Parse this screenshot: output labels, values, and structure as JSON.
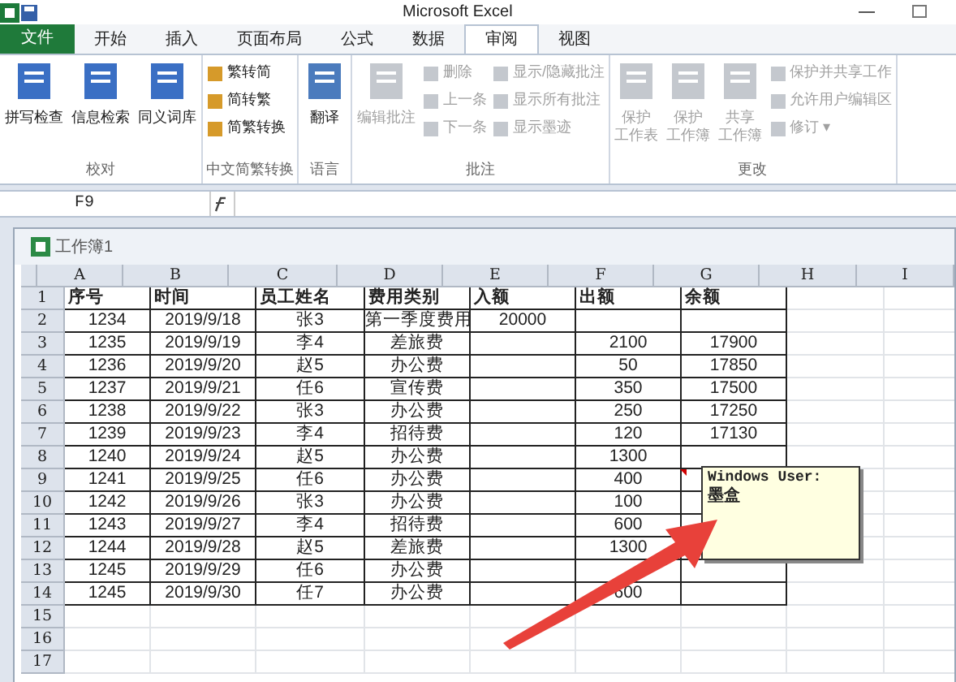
{
  "window": {
    "title": "Microsoft Excel"
  },
  "tabs": [
    {
      "label": "文件",
      "kind": "file",
      "selected": false
    },
    {
      "label": "开始",
      "kind": "tab",
      "selected": false
    },
    {
      "label": "插入",
      "kind": "tab",
      "selected": false
    },
    {
      "label": "页面布局",
      "kind": "tab",
      "selected": false
    },
    {
      "label": "公式",
      "kind": "tab",
      "selected": false
    },
    {
      "label": "数据",
      "kind": "tab",
      "selected": false
    },
    {
      "label": "审阅",
      "kind": "tab",
      "selected": true
    },
    {
      "label": "视图",
      "kind": "tab",
      "selected": false
    }
  ],
  "ribbon_groups": [
    {
      "label": "校对",
      "buttons": [
        {
          "label": "拼写检查",
          "kind": "large",
          "disabled": false
        },
        {
          "label": "信息检索",
          "kind": "large",
          "disabled": false
        },
        {
          "label": "同义词库",
          "kind": "large",
          "disabled": false
        }
      ]
    },
    {
      "label": "中文简繁转换",
      "buttons": [
        {
          "label": "繁转简",
          "kind": "small",
          "disabled": false
        },
        {
          "label": "简转繁",
          "kind": "small",
          "disabled": false
        },
        {
          "label": "简繁转换",
          "kind": "small",
          "disabled": false
        }
      ]
    },
    {
      "label": "语言",
      "buttons": [
        {
          "label": "翻译",
          "kind": "large",
          "disabled": false
        }
      ]
    },
    {
      "label": "批注",
      "buttons": [
        {
          "label": "编辑批注",
          "kind": "large",
          "disabled": true
        },
        {
          "label": "删除",
          "kind": "small",
          "disabled": true
        },
        {
          "label": "上一条",
          "kind": "small",
          "disabled": true
        },
        {
          "label": "下一条",
          "kind": "small",
          "disabled": true
        },
        {
          "label": "显示/隐藏批注",
          "kind": "small",
          "disabled": true
        },
        {
          "label": "显示所有批注",
          "kind": "small",
          "disabled": true
        },
        {
          "label": "显示墨迹",
          "kind": "small",
          "disabled": true
        }
      ]
    },
    {
      "label": "更改",
      "buttons": [
        {
          "label": [
            "保护",
            "工作表"
          ],
          "kind": "large",
          "disabled": true
        },
        {
          "label": [
            "保护",
            "工作簿"
          ],
          "kind": "large",
          "disabled": true
        },
        {
          "label": [
            "共享",
            "工作簿"
          ],
          "kind": "large",
          "disabled": true
        },
        {
          "label": "保护并共享工作",
          "kind": "small",
          "disabled": true
        },
        {
          "label": "允许用户编辑区",
          "kind": "small",
          "disabled": true
        },
        {
          "label": "修订 ▾",
          "kind": "small",
          "disabled": true
        }
      ]
    }
  ],
  "name_box": "F9",
  "workbook_title": "工作簿1",
  "columns": [
    "A",
    "B",
    "C",
    "D",
    "E",
    "F",
    "G",
    "H",
    "I"
  ],
  "rows": [
    {
      "number": "1",
      "cells": [
        "序号",
        "时间",
        "员工姓名",
        "费用类别",
        "入额",
        "出额",
        "余额"
      ]
    },
    {
      "number": "2",
      "cells": [
        "1234",
        "2019/9/18",
        "张3",
        "第一季度费用",
        "20000",
        null,
        null
      ]
    },
    {
      "number": "3",
      "cells": [
        "1235",
        "2019/9/19",
        "李4",
        "差旅费",
        null,
        "2100",
        "17900"
      ]
    },
    {
      "number": "4",
      "cells": [
        "1236",
        "2019/9/20",
        "赵5",
        "办公费",
        null,
        "50",
        "17850"
      ]
    },
    {
      "number": "5",
      "cells": [
        "1237",
        "2019/9/21",
        "任6",
        "宣传费",
        null,
        "350",
        "17500"
      ]
    },
    {
      "number": "6",
      "cells": [
        "1238",
        "2019/9/22",
        "张3",
        "办公费",
        null,
        "250",
        "17250"
      ]
    },
    {
      "number": "7",
      "cells": [
        "1239",
        "2019/9/23",
        "李4",
        "招待费",
        null,
        "120",
        "17130"
      ]
    },
    {
      "number": "8",
      "cells": [
        "1240",
        "2019/9/24",
        "赵5",
        "办公费",
        null,
        "1300",
        null
      ]
    },
    {
      "number": "9",
      "cells": [
        "1241",
        "2019/9/25",
        "任6",
        "办公费",
        null,
        "400",
        null
      ]
    },
    {
      "number": "10",
      "cells": [
        "1242",
        "2019/9/26",
        "张3",
        "办公费",
        null,
        "100",
        null
      ]
    },
    {
      "number": "11",
      "cells": [
        "1243",
        "2019/9/27",
        "李4",
        "招待费",
        null,
        "600",
        null
      ]
    },
    {
      "number": "12",
      "cells": [
        "1244",
        "2019/9/28",
        "赵5",
        "差旅费",
        null,
        "1300",
        null
      ]
    },
    {
      "number": "13",
      "cells": [
        "1245",
        "2019/9/29",
        "任6",
        "办公费",
        null,
        null,
        null
      ]
    },
    {
      "number": "14",
      "cells": [
        "1245",
        "2019/9/30",
        "任7",
        "办公费",
        null,
        "600",
        null
      ]
    },
    {
      "number": "15",
      "cells": []
    },
    {
      "number": "16",
      "cells": []
    },
    {
      "number": "17",
      "cells": []
    }
  ],
  "comment": {
    "author": "Windows User:",
    "text": "墨盒"
  }
}
